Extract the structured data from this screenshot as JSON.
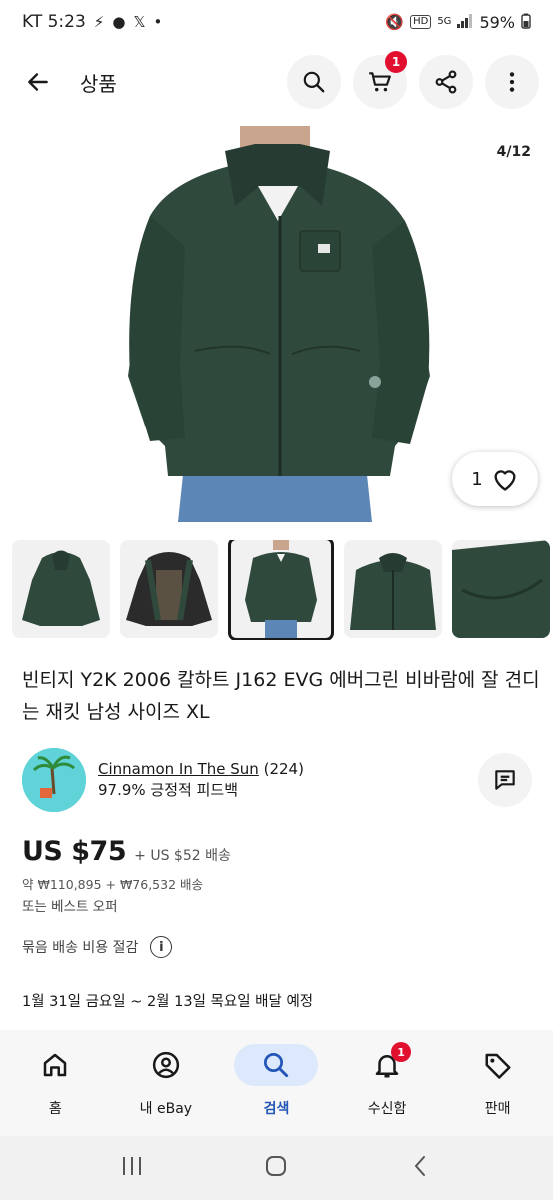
{
  "status_bar": {
    "carrier_time": "KT 5:23",
    "battery": "59%"
  },
  "appbar": {
    "title": "상품",
    "cart_count": "1"
  },
  "gallery": {
    "counter": "4/12",
    "favorite_count": "1"
  },
  "listing": {
    "title": "빈티지 Y2K 2006 칼하트 J162 EVG 에버그린 비바람에 잘 견디는 재킷 남성 사이즈 XL"
  },
  "seller": {
    "name": "Cinnamon In The Sun",
    "reviews": "(224)",
    "feedback": "97.9% 긍정적 피드백"
  },
  "pricing": {
    "price": "US $75",
    "shipping": "+ US $52 배송",
    "krw": "약 ₩110,895  + ₩76,532 배송",
    "best_offer": "또는 베스트 오퍼",
    "bundle": "묶음 배송 비용 절감",
    "delivery": "1월 31일 금요일 ~ 2월 13일 목요일 배달 예정"
  },
  "bottom_nav": {
    "items": [
      {
        "label": "홈"
      },
      {
        "label": "내 eBay"
      },
      {
        "label": "검색"
      },
      {
        "label": "수신함",
        "badge": "1"
      },
      {
        "label": "판매"
      }
    ]
  },
  "colors": {
    "accent": "#2456b8",
    "badge": "#e0102e",
    "jacket": "#2f4a3d"
  }
}
